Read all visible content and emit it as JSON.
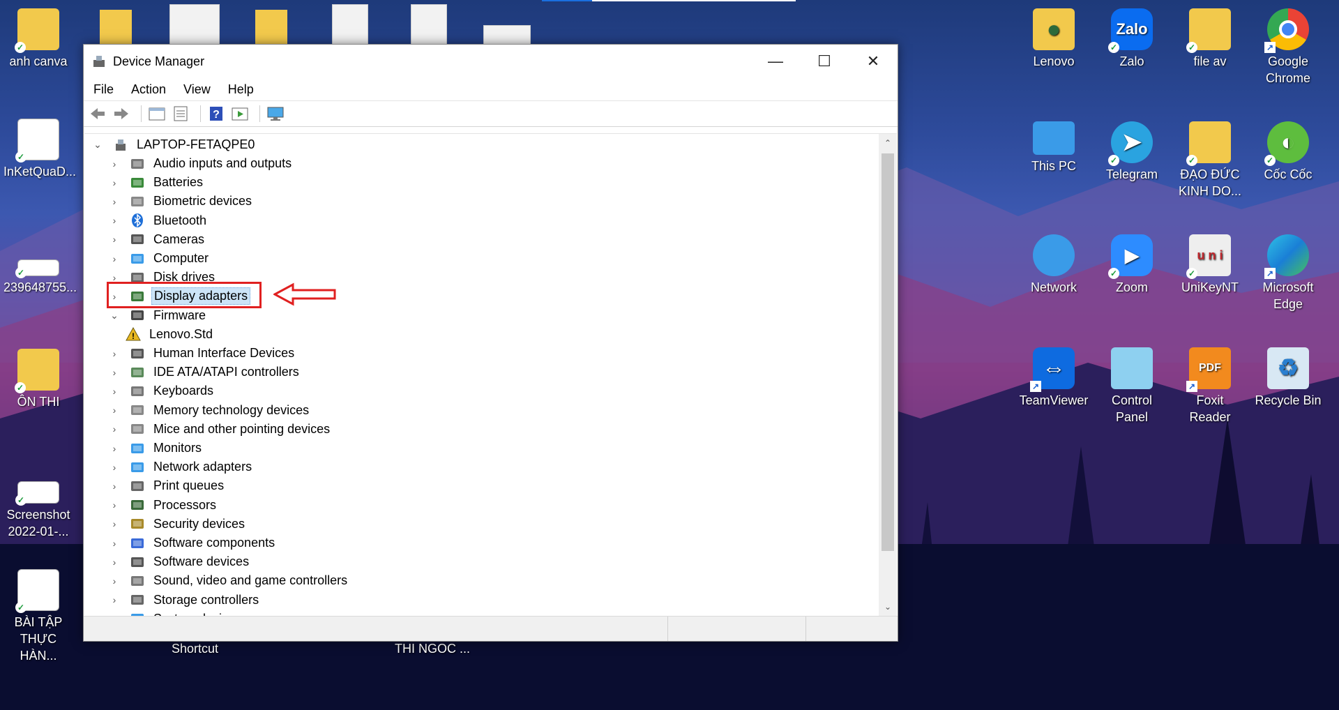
{
  "desktop": {
    "left_icons": [
      {
        "label": "anh canva",
        "icon": "folder-icon"
      },
      {
        "label": "InKetQuaD...",
        "icon": "document-icon"
      },
      {
        "label": "239648755...",
        "icon": "image-icon"
      },
      {
        "label": "ÔN THI",
        "icon": "folder-icon"
      },
      {
        "label": "Screenshot 2022-01-...",
        "icon": "image-icon"
      },
      {
        "label": "BÀI TẬP THỰC HÀN...",
        "icon": "word-document-icon"
      }
    ],
    "right_icons": [
      {
        "label": "Lenovo",
        "icon": "user-folder-icon"
      },
      {
        "label": "Zalo",
        "icon": "zalo-icon",
        "glyph": "Zalo"
      },
      {
        "label": "file av",
        "icon": "folder-icon"
      },
      {
        "label": "Google Chrome",
        "icon": "chrome-icon"
      },
      {
        "label": "This PC",
        "icon": "computer-icon"
      },
      {
        "label": "Telegram",
        "icon": "telegram-icon"
      },
      {
        "label": "ĐẠO ĐỨC KINH DO...",
        "icon": "folder-icon"
      },
      {
        "label": "Cốc Cốc",
        "icon": "coccoc-icon"
      },
      {
        "label": "Network",
        "icon": "network-icon"
      },
      {
        "label": "Zoom",
        "icon": "zoom-icon"
      },
      {
        "label": "UniKeyNT",
        "icon": "unikey-icon"
      },
      {
        "label": "Microsoft Edge",
        "icon": "edge-icon"
      },
      {
        "label": "TeamViewer",
        "icon": "teamviewer-icon"
      },
      {
        "label": "Control Panel",
        "icon": "control-panel-icon"
      },
      {
        "label": "Foxit Reader",
        "icon": "foxit-icon",
        "glyph": "PDF"
      },
      {
        "label": "Recycle Bin",
        "icon": "recycle-bin-icon"
      }
    ],
    "below_labels": [
      "Shortcut",
      "THI NGOC ..."
    ]
  },
  "window": {
    "title": "Device Manager",
    "controls": {
      "minimize": "—",
      "maximize": "☐",
      "close": "✕"
    },
    "menu": [
      "File",
      "Action",
      "View",
      "Help"
    ],
    "toolbar": [
      "back-icon",
      "forward-icon",
      "properties-icon",
      "list-icon",
      "help-icon",
      "run-icon",
      "monitor-icon"
    ],
    "root": "LAPTOP-FETAQPE0",
    "tree": [
      {
        "label": "Audio inputs and outputs",
        "icon": "speaker-icon",
        "expanded": false
      },
      {
        "label": "Batteries",
        "icon": "battery-icon",
        "expanded": false
      },
      {
        "label": "Biometric devices",
        "icon": "fingerprint-icon",
        "expanded": false
      },
      {
        "label": "Bluetooth",
        "icon": "bluetooth-icon",
        "expanded": false
      },
      {
        "label": "Cameras",
        "icon": "camera-icon",
        "expanded": false
      },
      {
        "label": "Computer",
        "icon": "computer-icon",
        "expanded": false
      },
      {
        "label": "Disk drives",
        "icon": "disk-icon",
        "expanded": false
      },
      {
        "label": "Display adapters",
        "icon": "display-adapter-icon",
        "expanded": false,
        "selected": true
      },
      {
        "label": "Firmware",
        "icon": "firmware-icon",
        "expanded": true
      },
      {
        "label": "Lenovo.Std",
        "icon": "warning-icon",
        "child": true
      },
      {
        "label": "Human Interface Devices",
        "icon": "hid-icon",
        "expanded": false
      },
      {
        "label": "IDE ATA/ATAPI controllers",
        "icon": "controller-icon",
        "expanded": false
      },
      {
        "label": "Keyboards",
        "icon": "keyboard-icon",
        "expanded": false
      },
      {
        "label": "Memory technology devices",
        "icon": "memory-icon",
        "expanded": false
      },
      {
        "label": "Mice and other pointing devices",
        "icon": "mouse-icon",
        "expanded": false
      },
      {
        "label": "Monitors",
        "icon": "monitor-icon",
        "expanded": false
      },
      {
        "label": "Network adapters",
        "icon": "network-adapter-icon",
        "expanded": false
      },
      {
        "label": "Print queues",
        "icon": "printer-icon",
        "expanded": false
      },
      {
        "label": "Processors",
        "icon": "processor-icon",
        "expanded": false
      },
      {
        "label": "Security devices",
        "icon": "security-icon",
        "expanded": false
      },
      {
        "label": "Software components",
        "icon": "software-component-icon",
        "expanded": false
      },
      {
        "label": "Software devices",
        "icon": "software-device-icon",
        "expanded": false
      },
      {
        "label": "Sound, video and game controllers",
        "icon": "sound-icon",
        "expanded": false
      },
      {
        "label": "Storage controllers",
        "icon": "storage-icon",
        "expanded": false
      },
      {
        "label": "System devices",
        "icon": "system-icon",
        "expanded": false
      }
    ]
  }
}
